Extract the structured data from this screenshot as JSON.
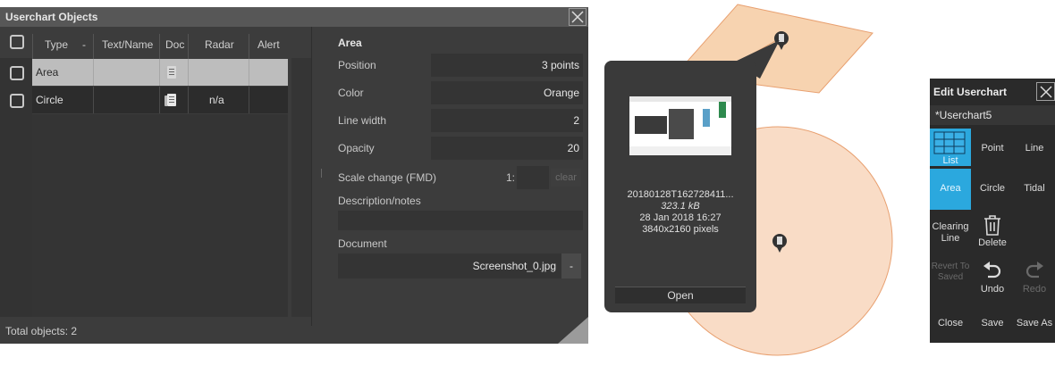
{
  "userchart_objects": {
    "title": "Userchart Objects",
    "headers": {
      "type": "Type",
      "sort_indicator": "-",
      "text_name": "Text/Name",
      "doc": "Doc",
      "radar": "Radar",
      "alert": "Alert"
    },
    "rows": [
      {
        "type": "Area",
        "text_name": "",
        "doc": "document-icon",
        "radar": "",
        "alert": "",
        "selected": true
      },
      {
        "type": "Circle",
        "text_name": "",
        "doc": "document-icon",
        "radar": "n/a",
        "alert": "",
        "selected": false
      }
    ],
    "footer": "Total objects: 2",
    "properties": {
      "heading": "Area",
      "position_label": "Position",
      "position_value": "3 points",
      "color_label": "Color",
      "color_value": "Orange",
      "line_width_label": "Line width",
      "line_width_value": "2",
      "opacity_label": "Opacity",
      "opacity_value": "20",
      "scale_label": "Scale change (FMD)",
      "scale_prefix": "1:",
      "scale_value": "",
      "clear_label": "clear",
      "description_label": "Description/notes",
      "description_value": "",
      "document_label": "Document",
      "document_value": "Screenshot_0.jpg",
      "document_remove": "-"
    }
  },
  "preview": {
    "filename": "20180128T162728411...",
    "size": "323.1 kB",
    "date": "28 Jan 2018 16:27",
    "dimensions": "3840x2160 pixels",
    "open_label": "Open"
  },
  "edit_userchart": {
    "title": "Edit Userchart",
    "chart_name": "*Userchart5",
    "tools": {
      "list": "List",
      "point": "Point",
      "line": "Line",
      "area": "Area",
      "circle": "Circle",
      "tidal": "Tidal",
      "clearing_line": "Clearing Line",
      "delete": "Delete",
      "revert": "Revert To Saved",
      "undo": "Undo",
      "redo": "Redo",
      "close": "Close",
      "save": "Save",
      "save_as": "Save As"
    },
    "active_tool": "Area"
  },
  "colors": {
    "accent": "#2ba8de",
    "selected_row": "#bdbdbd",
    "area_fill": "#f7d3b0",
    "circle_fill": "#f9dcc6",
    "shape_outline": "#e8a070",
    "panel_bg": "#3c3c3c"
  }
}
